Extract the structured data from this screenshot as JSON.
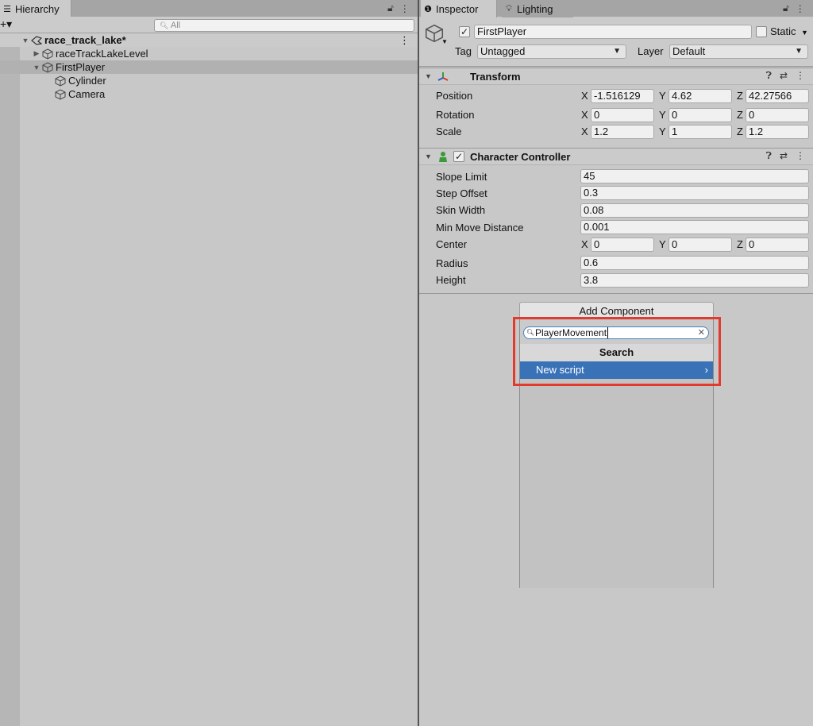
{
  "hierarchy": {
    "tab_label": "Hierarchy",
    "add_label": "+▾",
    "search_placeholder": "All",
    "scene": "race_track_lake*",
    "items": [
      {
        "label": "raceTrackLakeLevel"
      },
      {
        "label": "FirstPlayer"
      },
      {
        "label": "Cylinder"
      },
      {
        "label": "Camera"
      }
    ]
  },
  "inspector": {
    "tabs": [
      {
        "label": "Inspector"
      },
      {
        "label": "Lighting"
      }
    ],
    "object_name": "FirstPlayer",
    "static_label": "Static",
    "tag_label": "Tag",
    "tag_value": "Untagged",
    "layer_label": "Layer",
    "layer_value": "Default"
  },
  "transform": {
    "title": "Transform",
    "rows": [
      {
        "label": "Position",
        "x": "-1.516129",
        "y": "4.62",
        "z": "42.27566"
      },
      {
        "label": "Rotation",
        "x": "0",
        "y": "0",
        "z": "0"
      },
      {
        "label": "Scale",
        "x": "1.2",
        "y": "1",
        "z": "1.2"
      }
    ]
  },
  "axes": {
    "x": "X",
    "y": "Y",
    "z": "Z"
  },
  "character_controller": {
    "title": "Character Controller",
    "slope_limit": {
      "label": "Slope Limit",
      "value": "45"
    },
    "step_offset": {
      "label": "Step Offset",
      "value": "0.3"
    },
    "skin_width": {
      "label": "Skin Width",
      "value": "0.08"
    },
    "min_move": {
      "label": "Min Move Distance",
      "value": "0.001"
    },
    "center": {
      "label": "Center",
      "x": "0",
      "y": "0",
      "z": "0"
    },
    "radius": {
      "label": "Radius",
      "value": "0.6"
    },
    "height": {
      "label": "Height",
      "value": "3.8"
    }
  },
  "add_component": {
    "button_label": "Add Component",
    "search_value": "PlayerMovement",
    "section_title": "Search",
    "item_label": "New script"
  },
  "colors": {
    "highlight": "#e23b2e",
    "selection": "#3a72b8"
  }
}
